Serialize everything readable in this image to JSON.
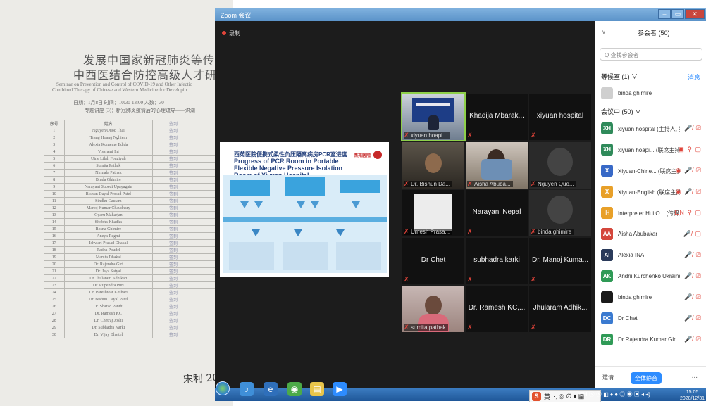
{
  "paper": {
    "title_cn_1": "发展中国家新冠肺炎等传染病",
    "title_cn_2": "中西医结合防控高级人才研修班",
    "title_en_1": "Seminar on Prevention and Control of COVID-19 and Other Infectio",
    "title_en_2": "Combined Therapy of Chinese and Western Medicine for Developin",
    "meta_1": "日期：1月8日    时间：10:30-13:00    人数：30",
    "meta_2": "专题讲座 (3)：新冠肺炎疫情后的心理疏导——洪湖",
    "col_headers": [
      "序号",
      "姓名",
      "签到"
    ],
    "rows": [
      [
        "1",
        "Nguyen Quoc Thai",
        "签到"
      ],
      [
        "2",
        "Trang Hoang Nghiem",
        "签到"
      ],
      [
        "3",
        "Alexia Kumeme Edida",
        "签到"
      ],
      [
        "4",
        "Visarami Ini",
        "签到"
      ],
      [
        "5",
        "Uine Lilah Fouziyah",
        "签到"
      ],
      [
        "6",
        "Sumita Pathak",
        "签到"
      ],
      [
        "7",
        "Nirmala Pathak",
        "签到"
      ],
      [
        "8",
        "Binda Ghimire",
        "签到"
      ],
      [
        "9",
        "Narayani Subedi Upayagain",
        "签到"
      ],
      [
        "10",
        "Bishun Dayal Prosad Patel",
        "签到"
      ],
      [
        "11",
        "Sindhu Gautam",
        "签到"
      ],
      [
        "12",
        "Manoj Kumar Chaudhary",
        "签到"
      ],
      [
        "13",
        "Gyaru Maharjan",
        "签到"
      ],
      [
        "14",
        "Shobha Khadka",
        "签到"
      ],
      [
        "15",
        "Rosna Ghimire",
        "签到"
      ],
      [
        "16",
        "Aneya Regmi",
        "签到"
      ],
      [
        "17",
        "Ishwari Prasad Dhakal",
        "签到"
      ],
      [
        "18",
        "Radha Poudel",
        "签到"
      ],
      [
        "19",
        "Mamta Dhakal",
        "签到"
      ],
      [
        "20",
        "Dr. Rajendra Giri",
        "签到"
      ],
      [
        "21",
        "Dr. Jaya Satyal",
        "签到"
      ],
      [
        "22",
        "Dr. Jhularam Adhikari",
        "签到"
      ],
      [
        "23",
        "Dr. Rupendra Puri",
        "签到"
      ],
      [
        "24",
        "Dr. Pareshwar Keshari",
        "签到"
      ],
      [
        "25",
        "Dr. Bishun Dayal Patel",
        "签到"
      ],
      [
        "26",
        "Dr. Sharad Panthi",
        "签到"
      ],
      [
        "27",
        "Dr. Ramesh KC",
        "签到"
      ],
      [
        "28",
        "Dr. Chetraj Joshi",
        "签到"
      ],
      [
        "29",
        "Dr. Subhadra Karki",
        "签到"
      ],
      [
        "30",
        "Dr. Vijay Bhattel",
        "签到"
      ]
    ],
    "signature": "宋利 2021"
  },
  "zoom": {
    "window_title": "Zoom 会议",
    "recording_label": "录制",
    "slide": {
      "header_cn": "西苑医院便携式柔性负压隔离病房PCR室进度",
      "title_en": "Progress of PCR Room in Portable Flexible Negative Pressure Isolation Room of Xiyuan Hospital",
      "logo_text": "西苑医院"
    },
    "tiles": [
      {
        "name": "",
        "label": "xiyuan hoapi...",
        "camera": true
      },
      {
        "name": "Khadija  Mbarak...",
        "label": "",
        "camera": false
      },
      {
        "name": "xiyuan hospital",
        "label": "",
        "camera": false
      },
      {
        "name": "",
        "label": "Dr. Bishun Da...",
        "camera": true
      },
      {
        "name": "",
        "label": "Aisha Abuba...",
        "camera": true
      },
      {
        "name": "",
        "label": "Nguyen Quo...",
        "camera": true
      },
      {
        "name": "",
        "label": "Umesh Prasa...",
        "camera": true
      },
      {
        "name": "Narayani Nepal",
        "label": "",
        "camera": false
      },
      {
        "name": "",
        "label": "binda ghimire",
        "camera": true
      },
      {
        "name": "Dr Chet",
        "label": "",
        "camera": false
      },
      {
        "name": "subhadra karki",
        "label": "",
        "camera": false
      },
      {
        "name": "Dr. Manoj Kuma...",
        "label": "",
        "camera": false
      },
      {
        "name": "",
        "label": "sumita pathak",
        "camera": true
      },
      {
        "name": "Dr. Ramesh KC,...",
        "label": "",
        "camera": false
      },
      {
        "name": "Jhularam  Adhik...",
        "label": "",
        "camera": false
      }
    ],
    "panel": {
      "title": "参会者 (50)",
      "search_placeholder": "Q 查找参会者",
      "waiting_label": "等候室 (1) ∨",
      "message_label": "消息",
      "waiting_name": "binda ghimire",
      "in_meeting_label": "会议中 (50) ∨",
      "participants": [
        {
          "initials": "XH",
          "name": "xiyuan hospital (主持人, 我)",
          "color": "#2f8a5a",
          "status": "🎤̸ ⎚"
        },
        {
          "initials": "XH",
          "name": "xiyuan hoapi... (联席主持人)",
          "color": "#2f8a5a",
          "status": "▣ ⚲ ▢"
        },
        {
          "initials": "X",
          "name": "Xiyuan-Chine... (联席主持人)",
          "color": "#3869c7",
          "status": "◉ 🎤̸ ⎚"
        },
        {
          "initials": "X",
          "name": "Xiyuan-English (联席主持人)",
          "color": "#e8a029",
          "status": "◉ 🎤̸ ⎚"
        },
        {
          "initials": "IH",
          "name": "Interpreter Hui O... (传译员)",
          "color": "#e8a029",
          "status": "EN ⚲ ▢"
        },
        {
          "initials": "AA",
          "name": "Aisha Abubakar",
          "color": "#d4473c",
          "status": "🎤̸ ▢"
        },
        {
          "initials": "AI",
          "name": "Alexia INA",
          "color": "#2a3a5a",
          "status": "🎤̸ ⎚"
        },
        {
          "initials": "AK",
          "name": "Andrii Kurchenko Ukraine",
          "color": "#2f9a56",
          "status": "🎤̸ ⎚"
        },
        {
          "initials": "",
          "name": "binda ghimire",
          "color": "#1a1a1a",
          "status": "🎤̸ ⎚"
        },
        {
          "initials": "DC",
          "name": "Dr Chet",
          "color": "#3a7ad0",
          "status": "🎤̸ ⎚"
        },
        {
          "initials": "DR",
          "name": "Dr Rajendra Kumar Giri",
          "color": "#2f9a56",
          "status": "🎤̸ ⎚"
        }
      ],
      "footer_invite": "邀请",
      "footer_mute_all": "全体静音",
      "footer_more": "..."
    }
  },
  "ime": {
    "logo": "S",
    "mode": "英",
    "symbols": "·, ◎ ∅ ♦ ▦"
  },
  "taskbar": {
    "tray": "CH ⓢ ⓢ ◧ ♦ ● ◎ ◉ ▣ ◂ ◂)",
    "time": "15:05",
    "date": "2020/12/31"
  }
}
